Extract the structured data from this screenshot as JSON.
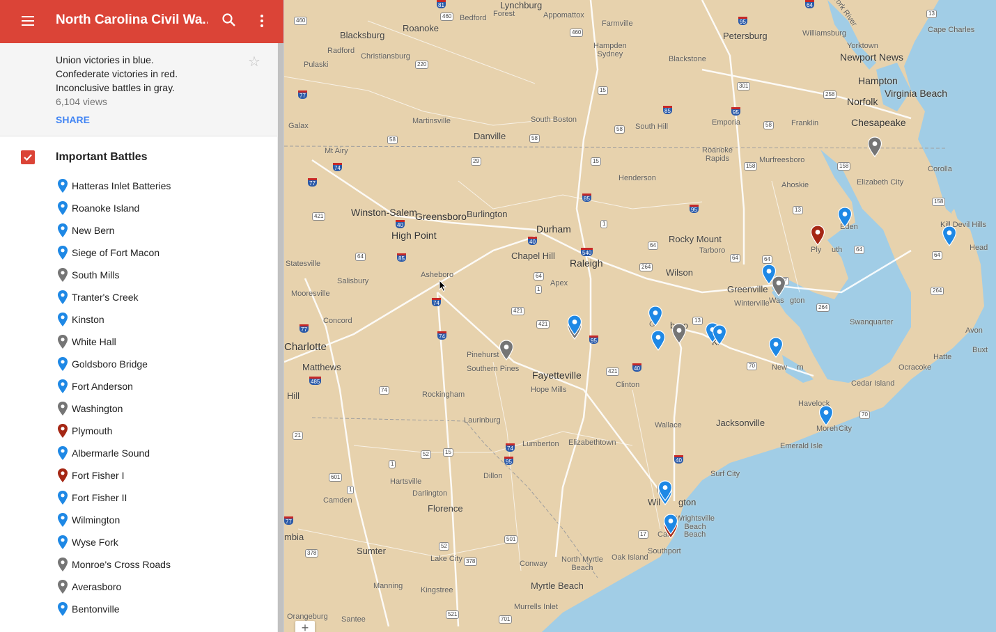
{
  "app": {
    "title": "North Carolina Civil Wa...",
    "description": [
      "Union victories in blue.",
      "Confederate victories in red.",
      "Inconclusive battles in gray."
    ],
    "views": "6,104 views",
    "share_label": "SHARE"
  },
  "layer": {
    "name": "Important Battles",
    "checked": true
  },
  "colors": {
    "union": "#1e88e5",
    "confederate": "#a52714",
    "inconclusive": "#757575",
    "accent": "#db4437",
    "water": "#a1cde6",
    "land": "#e7d2ad"
  },
  "battles": [
    {
      "name": "Hatteras Inlet Batteries",
      "result": "union"
    },
    {
      "name": "Roanoke Island",
      "result": "union"
    },
    {
      "name": "New Bern",
      "result": "union"
    },
    {
      "name": "Siege of Fort Macon",
      "result": "union"
    },
    {
      "name": "South Mills",
      "result": "inconclusive"
    },
    {
      "name": "Tranter's Creek",
      "result": "union"
    },
    {
      "name": "Kinston",
      "result": "union"
    },
    {
      "name": "White Hall",
      "result": "inconclusive"
    },
    {
      "name": "Goldsboro Bridge",
      "result": "union"
    },
    {
      "name": "Fort Anderson",
      "result": "union"
    },
    {
      "name": "Washington",
      "result": "inconclusive"
    },
    {
      "name": "Plymouth",
      "result": "confederate"
    },
    {
      "name": "Albermarle Sound",
      "result": "union"
    },
    {
      "name": "Fort Fisher I",
      "result": "confederate"
    },
    {
      "name": "Fort Fisher II",
      "result": "union"
    },
    {
      "name": "Wilmington",
      "result": "union"
    },
    {
      "name": "Wyse Fork",
      "result": "union"
    },
    {
      "name": "Monroe's Cross Roads",
      "result": "inconclusive"
    },
    {
      "name": "Averasboro",
      "result": "inconclusive"
    },
    {
      "name": "Bentonville",
      "result": "union"
    }
  ],
  "map": {
    "places": {
      "lynchburg": "Lynchburg",
      "forest": "Forest",
      "bedford": "Bedford",
      "appomattox": "Appomattox",
      "farmville": "Farmville",
      "petersburg": "Petersburg",
      "williamsburg": "Williamsburg",
      "york_river": "York River",
      "cape_charles": "Cape Charles",
      "blacksburg": "Blacksburg",
      "roanoke": "Roanoke",
      "radford": "Radford",
      "christiansburg": "Christiansburg",
      "hampden_sydney": "Hampden\nSydney",
      "blackstone": "Blackstone",
      "newport_news": "Newport News",
      "hampton": "Hampton",
      "virginia_beach": "Virginia Beach",
      "yorktown": "Yorktown",
      "norfolk": "Norfolk",
      "chesapeake": "Chesapeake",
      "pulaski": "Pulaski",
      "galax": "Galax",
      "martinsville": "Martinsville",
      "south_boston": "South Boston",
      "south_hill": "South Hill",
      "emporia": "Emporia",
      "franklin": "Franklin",
      "danville": "Danville",
      "mt_airy": "Mt Airy",
      "roanoke_rapids": "Roanoke\nRapids",
      "murfreesboro": "Murfreesboro",
      "ahoskie": "Ahoskie",
      "elizabeth_city": "Elizabeth City",
      "corolla": "Corolla",
      "henderson": "Henderson",
      "kill_devil_hills": "Kill Devil Hills",
      "winston_salem": "Winston-Salem",
      "greensboro": "Greensboro",
      "burlington": "Burlington",
      "high_point": "High Point",
      "durham": "Durham",
      "rocky_mount": "Rocky Mount",
      "tarboro": "Tarboro",
      "edenton": "Eden",
      "plymouth": "Ply",
      "plymouth2": "uth",
      "nags_head": "Head",
      "statesville": "Statesville",
      "chapel_hill": "Chapel Hill",
      "raleigh": "Raleigh",
      "wilson": "Wilson",
      "salisbury": "Salisbury",
      "asheboro": "Asheboro",
      "apex": "Apex",
      "greenville": "Greenville",
      "winterville": "Winterville",
      "washington": "Was",
      "washington2": "gton",
      "mooresville": "Mooresville",
      "swanquarter": "Swanquarter",
      "avon": "Avon",
      "concord": "Concord",
      "goldsboro": "G",
      "goldsboro2": "boro",
      "kinston": "Ki",
      "charlotte": "Charlotte",
      "matthews": "Matthews",
      "pinehurst": "Pinehurst",
      "southern_pines": "Southern Pines",
      "fayetteville": "Fayetteville",
      "hope_mills": "Hope Mills",
      "clinton": "Clinton",
      "new_bern": "New",
      "new_bern2": "rn",
      "hatteras": "Hatte",
      "ocracoke": "Ocracoke",
      "buxton": "Buxt",
      "cedar_island": "Cedar Island",
      "hill": "Hill",
      "rockingham": "Rockingham",
      "havelock": "Havelock",
      "laurinburg": "Laurinburg",
      "wallace": "Wallace",
      "jacksonville": "Jacksonville",
      "morehead": "Moreh",
      "morehead2": "City",
      "emerald_isle": "Emerald Isle",
      "lumberton": "Lumberton",
      "elizabethtown": "Elizabethtown",
      "dillon": "Dillon",
      "hartsville": "Hartsville",
      "darlington": "Darlington",
      "surf_city": "Surf City",
      "camden": "Camden",
      "florence": "Florence",
      "wilmington": "Wil",
      "wilmington2": "gton",
      "wrightsville": "Wrightsville\nBeach",
      "carolina_beach": "Car",
      "carolina_beach2": "Beach",
      "southport": "Southport",
      "sumter": "Sumter",
      "lake_city": "Lake City",
      "conway": "Conway",
      "north_myrtle": "North Myrtle\nBeach",
      "oak_island": "Oak Island",
      "mbia": "mbia",
      "manning": "Manning",
      "kingstree": "Kingstree",
      "myrtle_beach": "Myrtle Beach",
      "murrells_inlet": "Murrells Inlet",
      "orangeburg": "Orangeburg",
      "santee": "Santee"
    },
    "zoom_label": "+"
  }
}
